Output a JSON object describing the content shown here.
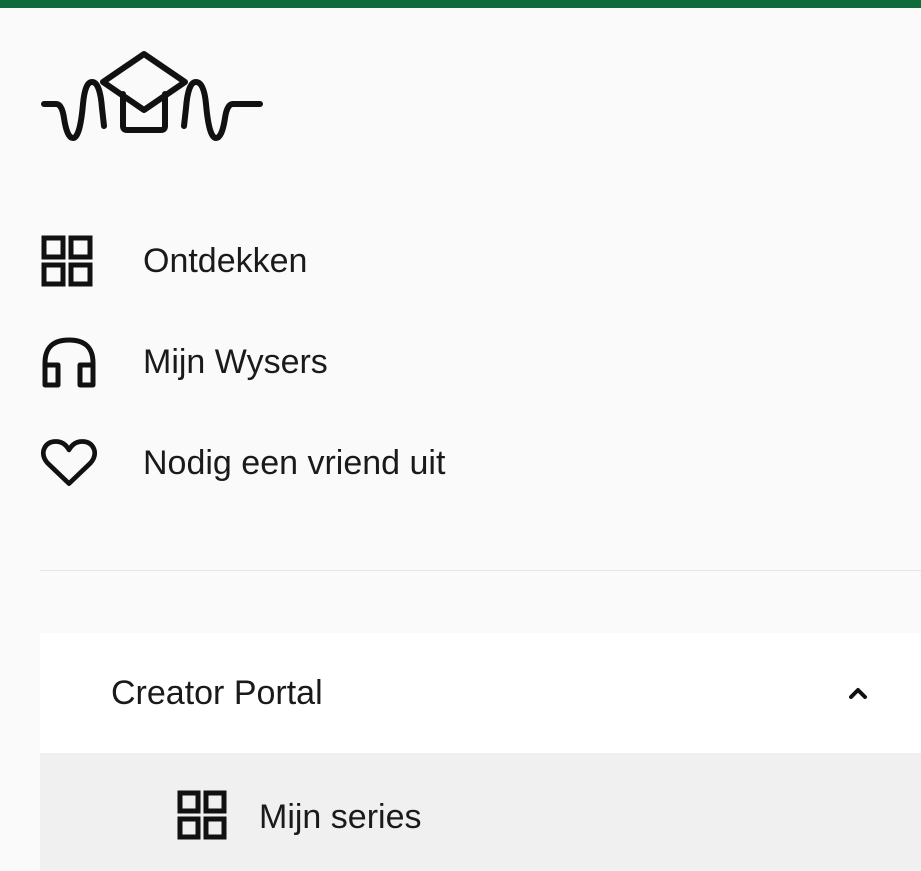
{
  "brand": {
    "accent_color": "#0f6b3c",
    "logo_icon": "graduation-cap-soundwave-logo"
  },
  "nav": {
    "items": [
      {
        "label": "Ontdekken",
        "icon": "grid-icon"
      },
      {
        "label": "Mijn Wysers",
        "icon": "headphones-icon"
      },
      {
        "label": "Nodig een vriend uit",
        "icon": "heart-icon"
      }
    ]
  },
  "creator_portal": {
    "title": "Creator Portal",
    "expanded": true,
    "toggle_icon": "chevron-up-icon",
    "items": [
      {
        "label": "Mijn series",
        "icon": "grid-icon"
      }
    ]
  }
}
